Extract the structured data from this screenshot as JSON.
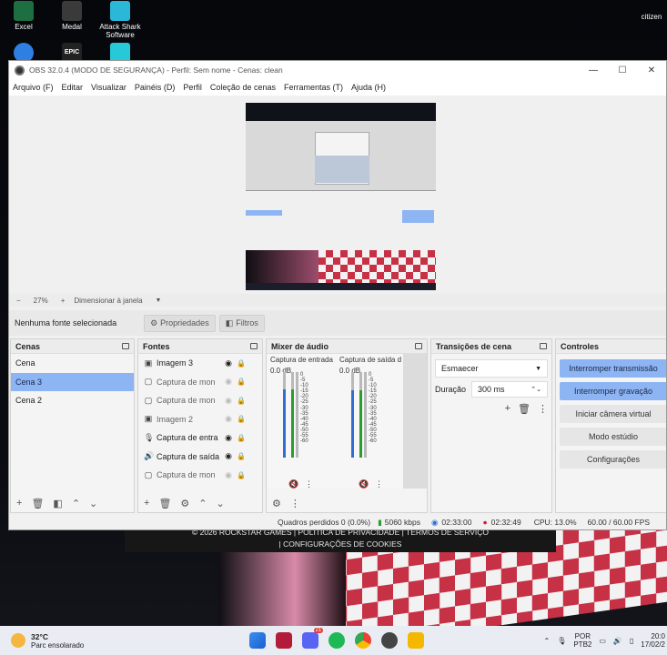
{
  "desktop": {
    "icons": [
      {
        "label": "Excel",
        "color": "#1d6f42"
      },
      {
        "label": "Medal",
        "color": "#3a3a3a"
      },
      {
        "label": "Attack Shark Software",
        "color": "#2ab7d8"
      },
      {
        "label": "citizen",
        "color": "#444"
      }
    ],
    "icon_row2": [
      {
        "label": "",
        "color": "#2f7fe3"
      },
      {
        "label": "EPIC",
        "color": "#222"
      },
      {
        "label": "",
        "color": "#25c9d7"
      }
    ],
    "rockstar_line1": "© 2026 ROCKSTAR GAMES | POLÍTICA DE PRIVACIDADE | TERMOS DE SERVIÇO",
    "rockstar_line2": "| CONFIGURAÇÕES DE COOKIES"
  },
  "window": {
    "title": "OBS 32.0.4 (MODO DE SEGURANÇA) - Perfil: Sem nome - Cenas: clean",
    "controls": [
      "—",
      "☐",
      "✕"
    ]
  },
  "menu": [
    "Arquivo (F)",
    "Editar",
    "Visualizar",
    "Painéis (D)",
    "Perfil",
    "Coleção de cenas",
    "Ferramentas (T)",
    "Ajuda (H)"
  ],
  "zoom": {
    "minus": "−",
    "value": "27%",
    "plus": "+",
    "mode": "Dimensionar à janela"
  },
  "source_toolbar": {
    "no_source": "Nenhuma fonte selecionada",
    "properties": "Propriedades",
    "filters": "Filtros"
  },
  "scenes": {
    "title": "Cenas",
    "items": [
      "Cena",
      "Cena 3",
      "Cena 2"
    ],
    "selected": 1
  },
  "sources": {
    "title": "Fontes",
    "items": [
      {
        "icon": "image-icon",
        "glyph": "▣",
        "label": "Imagem 3",
        "visible": true
      },
      {
        "icon": "window-icon",
        "glyph": "▢",
        "label": "Captura de mon",
        "visible": false
      },
      {
        "icon": "window-icon",
        "glyph": "▢",
        "label": "Captura de mon",
        "visible": false
      },
      {
        "icon": "image-icon",
        "glyph": "▣",
        "label": "Imagem 2",
        "visible": false
      },
      {
        "icon": "microphone-icon",
        "glyph": "🎙",
        "label": "Captura de entra",
        "visible": true
      },
      {
        "icon": "speaker-icon",
        "glyph": "🔊",
        "label": "Captura de saída",
        "visible": true
      },
      {
        "icon": "window-icon",
        "glyph": "▢",
        "label": "Captura de mon",
        "visible": false
      }
    ]
  },
  "mixer": {
    "title": "Mixer de áudio",
    "channels": [
      {
        "name": "Captura de entrada",
        "db": "0.0 dB",
        "level": 0.82
      },
      {
        "name": "Captura de saída d",
        "db": "0.0 dB",
        "level": 0.8
      }
    ],
    "scale": [
      "0",
      "-5",
      "-10",
      "-15",
      "-20",
      "-25",
      "-30",
      "-35",
      "-40",
      "-45",
      "-50",
      "-55",
      "-60"
    ]
  },
  "transitions": {
    "title": "Transições de cena",
    "selected": "Esmaecer",
    "duration_label": "Duração",
    "duration_value": "300 ms"
  },
  "controls": {
    "title": "Controles",
    "buttons": [
      {
        "label": "Interromper transmissão",
        "active": true
      },
      {
        "label": "Interromper gravação",
        "active": true
      },
      {
        "label": "Iniciar câmera virtual",
        "active": false
      },
      {
        "label": "Modo estúdio",
        "active": false
      },
      {
        "label": "Configurações",
        "active": false
      }
    ]
  },
  "status": {
    "dropped": "Quadros perdidos 0 (0.0%)",
    "bitrate": "5060 kbps",
    "stream_time": "02:33:00",
    "rec_time": "02:32:49",
    "cpu": "CPU: 13.0%",
    "fps": "60.00 / 60.00 FPS"
  },
  "taskbar": {
    "weather_temp": "32°C",
    "weather_desc": "Parc ensolarado",
    "lang1": "POR",
    "lang2": "PTB2",
    "time": "20:0",
    "date": "17/02/2",
    "discord_badge": "21",
    "colors": {
      "accent": "#2f6fd2",
      "record": "#d11c2a",
      "selected": "#8db4f3"
    }
  }
}
